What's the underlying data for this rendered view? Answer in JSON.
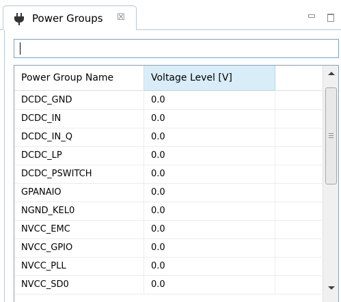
{
  "view": {
    "icon": "power-plug-icon",
    "title": "Power Groups",
    "close_glyph": "☒"
  },
  "filter": {
    "value": "",
    "placeholder": ""
  },
  "table": {
    "columns": [
      "Power Group Name",
      "Voltage Level [V]"
    ],
    "rows": [
      {
        "name": "DCDC_GND",
        "voltage": "0.0"
      },
      {
        "name": "DCDC_IN",
        "voltage": "0.0"
      },
      {
        "name": "DCDC_IN_Q",
        "voltage": "0.0"
      },
      {
        "name": "DCDC_LP",
        "voltage": "0.0"
      },
      {
        "name": "DCDC_PSWITCH",
        "voltage": "0.0"
      },
      {
        "name": "GPANAIO",
        "voltage": "0.0"
      },
      {
        "name": "NGND_KEL0",
        "voltage": "0.0"
      },
      {
        "name": "NVCC_EMC",
        "voltage": "0.0"
      },
      {
        "name": "NVCC_GPIO",
        "voltage": "0.0"
      },
      {
        "name": "NVCC_PLL",
        "voltage": "0.0"
      },
      {
        "name": "NVCC_SD0",
        "voltage": "0.0"
      }
    ]
  },
  "colors": {
    "selected_header": "#d9edf9",
    "border": "#b4c6d8"
  }
}
